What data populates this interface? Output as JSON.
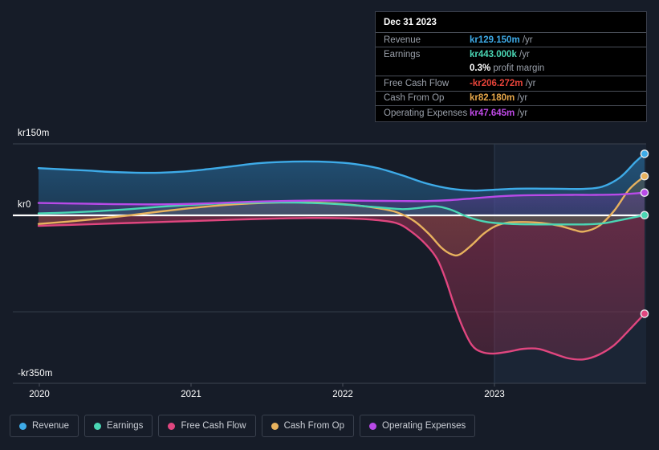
{
  "tooltip": {
    "date": "Dec 31 2023",
    "rows": [
      {
        "label": "Revenue",
        "value": "kr129.150m",
        "unit": "/yr",
        "color": "#3eabe8"
      },
      {
        "label": "Earnings",
        "value": "kr443.000k",
        "unit": "/yr",
        "color": "#4ad6b4"
      },
      {
        "label": "",
        "value": "0.3%",
        "unit": "profit margin",
        "color": "#ffffff"
      },
      {
        "label": "Free Cash Flow",
        "value": "-kr206.272m",
        "unit": "/yr",
        "color": "#e8443a"
      },
      {
        "label": "Cash From Op",
        "value": "kr82.180m",
        "unit": "/yr",
        "color": "#e8a84a"
      },
      {
        "label": "Operating Expenses",
        "value": "kr47.645m",
        "unit": "/yr",
        "color": "#c04ae8"
      }
    ]
  },
  "legend": {
    "items": [
      {
        "label": "Revenue",
        "color": "#3eabe8"
      },
      {
        "label": "Earnings",
        "color": "#4ad6b4"
      },
      {
        "label": "Free Cash Flow",
        "color": "#e0467f"
      },
      {
        "label": "Cash From Op",
        "color": "#e8b25e"
      },
      {
        "label": "Operating Expenses",
        "color": "#b84ae8"
      }
    ]
  },
  "axis": {
    "y_ticks": [
      {
        "label": "kr150m",
        "value": 150
      },
      {
        "label": "kr0",
        "value": 0
      },
      {
        "label": "-kr350m",
        "value": -350
      }
    ],
    "x_ticks": [
      "2020",
      "2021",
      "2022",
      "2023"
    ]
  },
  "chart_data": {
    "type": "area",
    "title": "",
    "xlabel": "",
    "ylabel": "",
    "ylim": [
      -350,
      150
    ],
    "xlim": [
      2019.75,
      2024.0
    ],
    "grid": true,
    "legend_position": "bottom",
    "currency": "kr",
    "unit": "millions",
    "x": [
      2019.75,
      2020.0,
      2020.25,
      2020.5,
      2020.75,
      2021.0,
      2021.25,
      2021.5,
      2021.75,
      2022.0,
      2022.25,
      2022.5,
      2022.75,
      2023.0,
      2023.25,
      2023.5,
      2023.75,
      2024.0
    ],
    "series": [
      {
        "name": "Revenue",
        "color": "#3eabe8",
        "values": [
          99,
          96,
          93,
          90,
          89,
          90,
          95,
          103,
          110,
          113,
          110,
          100,
          80,
          58,
          52,
          56,
          58,
          60,
          129
        ]
      },
      {
        "name": "Earnings",
        "color": "#4ad6b4",
        "values": [
          4,
          5,
          7,
          10,
          14,
          20,
          24,
          26,
          27,
          26,
          22,
          16,
          12,
          18,
          14,
          -10,
          -18,
          -18,
          -12,
          0.4
        ]
      },
      {
        "name": "Free Cash Flow",
        "color": "#e0467f",
        "values": [
          -22,
          -20,
          -18,
          -16,
          -14,
          -12,
          -10,
          -8,
          -6,
          -5,
          -6,
          -10,
          -30,
          -75,
          -190,
          -290,
          -282,
          -300,
          -206
        ]
      },
      {
        "name": "Cash From Op",
        "color": "#e8b25e",
        "values": [
          -18,
          -14,
          -10,
          -4,
          4,
          12,
          18,
          23,
          26,
          27,
          24,
          16,
          0,
          -48,
          -85,
          -30,
          -18,
          -22,
          -36,
          82
        ]
      },
      {
        "name": "Operating Expenses",
        "color": "#b84ae8",
        "values": [
          26,
          25,
          24,
          23,
          23,
          24,
          26,
          28,
          30,
          31,
          31,
          30,
          30,
          34,
          40,
          42,
          43,
          43,
          47.6
        ]
      }
    ],
    "final_markers": [
      {
        "name": "Revenue",
        "value": 129.15,
        "color": "#3eabe8"
      },
      {
        "name": "Cash From Op",
        "value": 82.18,
        "color": "#e8b25e"
      },
      {
        "name": "Operating Expenses",
        "value": 47.645,
        "color": "#b84ae8"
      },
      {
        "name": "Earnings",
        "value": 0.443,
        "color": "#4ad6b4"
      },
      {
        "name": "Free Cash Flow",
        "value": -206.272,
        "color": "#e0467f"
      }
    ]
  }
}
